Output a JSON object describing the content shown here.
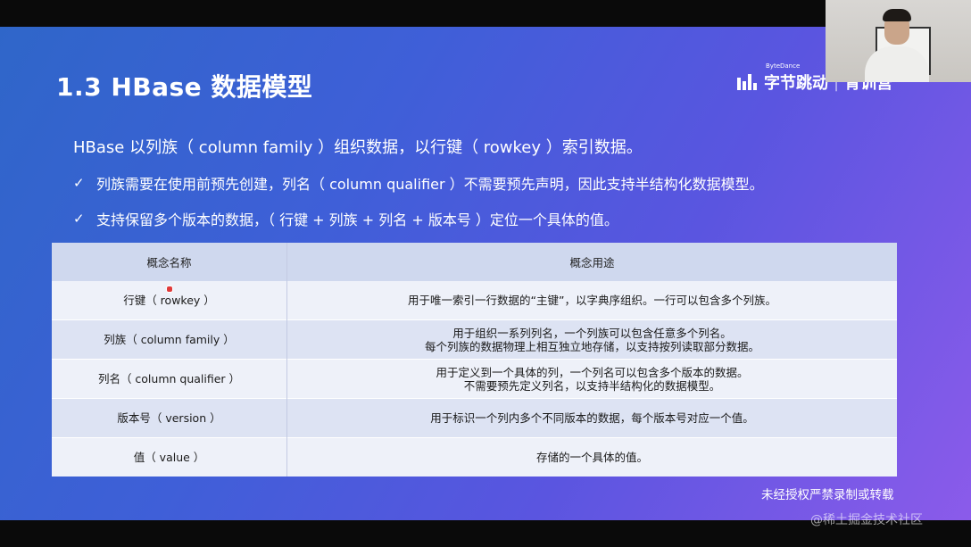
{
  "slide": {
    "title": "1.3 HBase 数据模型",
    "lead": "HBase 以列族（ column family ）组织数据，以行键（ rowkey ）索引数据。",
    "bullets": [
      "列族需要在使用前预先创建，列名（ column qualifier ）不需要预先声明，因此支持半结构化数据模型。",
      "支持保留多个版本的数据，（ 行键 + 列族 + 列名 + 版本号 ）定位一个具体的值。"
    ],
    "bullet_icon": "check-icon",
    "notice": "未经授权严禁录制或转载"
  },
  "logo": {
    "icon": "bytedance-logo-icon",
    "sup": "ByteDance",
    "text": "字节跳动",
    "text2": "青训营"
  },
  "table": {
    "headers": [
      "概念名称",
      "概念用途"
    ],
    "rows": [
      {
        "name": "行键（ rowkey ）",
        "use": "用于唯一索引一行数据的“主键”，以字典序组织。一行可以包含多个列族。"
      },
      {
        "name": "列族（ column family ）",
        "use": "用于组织一系列列名，一个列族可以包含任意多个列名。\n每个列族的数据物理上相互独立地存储，以支持按列读取部分数据。"
      },
      {
        "name": "列名（ column qualifier ）",
        "use": "用于定义到一个具体的列，一个列名可以包含多个版本的数据。\n不需要预先定义列名，以支持半结构化的数据模型。"
      },
      {
        "name": "版本号（ version ）",
        "use": "用于标识一个列内多个不同版本的数据，每个版本号对应一个值。"
      },
      {
        "name": "值（ value ）",
        "use": "存储的一个具体的值。"
      }
    ]
  },
  "watermark": "@稀土掘金技术社区",
  "colors": {
    "gradient_start": "#2f66c9",
    "gradient_end": "#8b5bea",
    "header_bg": "#cfd8ee",
    "row_light": "#eef1f9",
    "row_dark": "#dde3f3"
  }
}
